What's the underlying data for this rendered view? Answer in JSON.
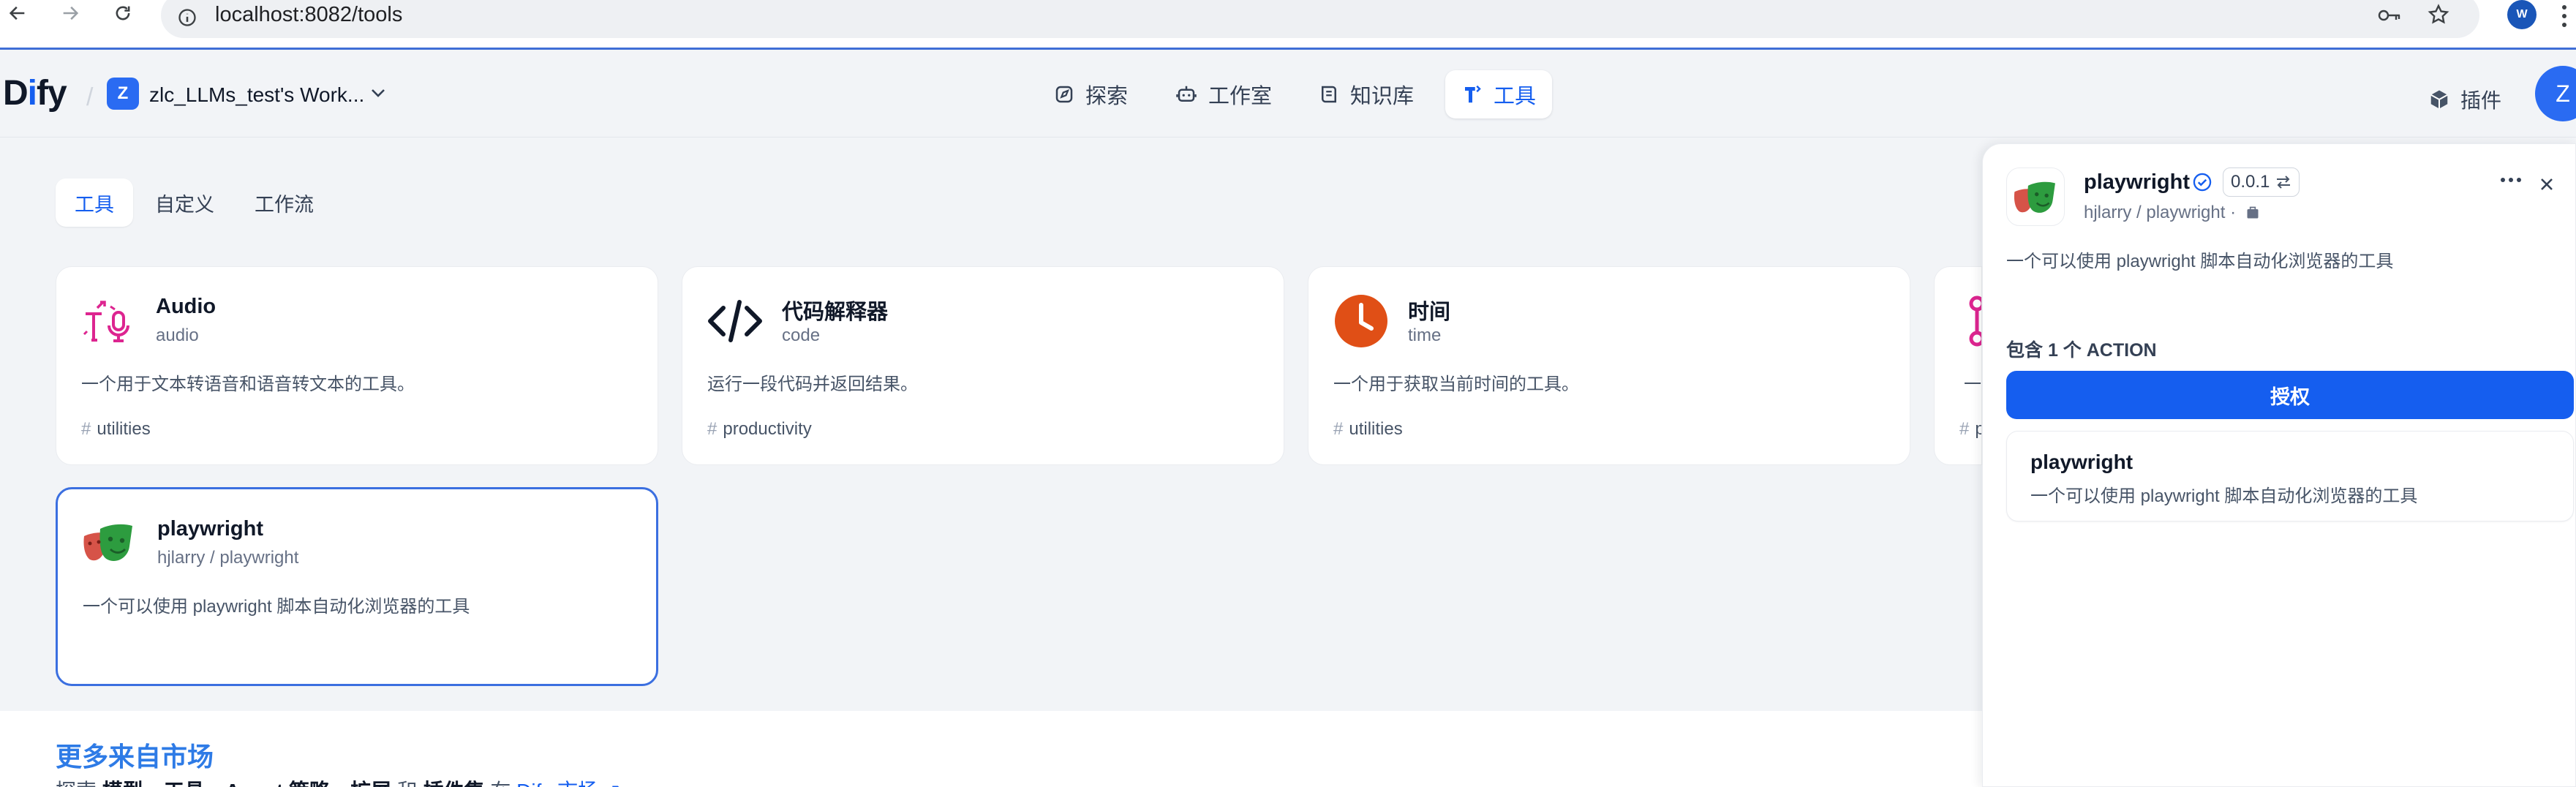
{
  "browser": {
    "url": "localhost:8082/tools",
    "profile_initial": "W"
  },
  "header": {
    "logo_pre": "D",
    "logo_dot": "i",
    "logo_post": "fy",
    "workspace_initial": "Z",
    "workspace_name": "zlc_LLMs_test's Work...",
    "nav": [
      {
        "label": "探索",
        "icon": "explore-icon"
      },
      {
        "label": "工作室",
        "icon": "robot-icon"
      },
      {
        "label": "知识库",
        "icon": "book-icon"
      },
      {
        "label": "工具",
        "icon": "tools-icon",
        "active": true
      }
    ],
    "plugins_label": "插件",
    "user_initial": "Z"
  },
  "tabs": [
    {
      "label": "工具",
      "active": true
    },
    {
      "label": "自定义"
    },
    {
      "label": "工作流"
    }
  ],
  "cards": [
    {
      "title": "Audio",
      "sub": "audio",
      "desc": "一个用于文本转语音和语音转文本的工具。",
      "tag": "utilities",
      "icon": "audio-icon"
    },
    {
      "title": "代码解释器",
      "sub": "code",
      "desc": "运行一段代码并返回结果。",
      "tag": "productivity",
      "icon": "code-icon"
    },
    {
      "title": "时间",
      "sub": "time",
      "desc": "一个用于获取当前时间的工具。",
      "tag": "utilities",
      "icon": "clock-icon"
    },
    {
      "title": "",
      "sub": "",
      "desc": "一",
      "tag": "p",
      "icon": "pink-node-icon"
    },
    {
      "title": "playwright",
      "sub": "hjlarry / playwright",
      "desc": "一个可以使用 playwright 脚本自动化浏览器的工具",
      "tag": "",
      "icon": "theater-masks-icon",
      "selected": true
    }
  ],
  "marketplace": {
    "title": "更多来自市场",
    "sub_prefix": "探索",
    "sub_b1": "模型",
    "sub_sep1": "、",
    "sub_b2": "工具",
    "sub_sep2": "、",
    "sub_b3": "Agent 策略",
    "sub_sep3": "、",
    "sub_b4": "扩展",
    "sub_and": "和",
    "sub_b5": "插件集",
    "sub_in": "在",
    "sub_link": "Dify 市场 ↗"
  },
  "panel": {
    "title": "playwright",
    "version": "0.0.1",
    "author": "hjlarry / playwright ·",
    "desc": "一个可以使用 playwright 脚本自动化浏览器的工具",
    "actions_label": "包含 1 个 ACTION",
    "auth_button": "授权",
    "action": {
      "name": "playwright",
      "desc": "一个可以使用 playwright 脚本自动化浏览器的工具"
    }
  }
}
